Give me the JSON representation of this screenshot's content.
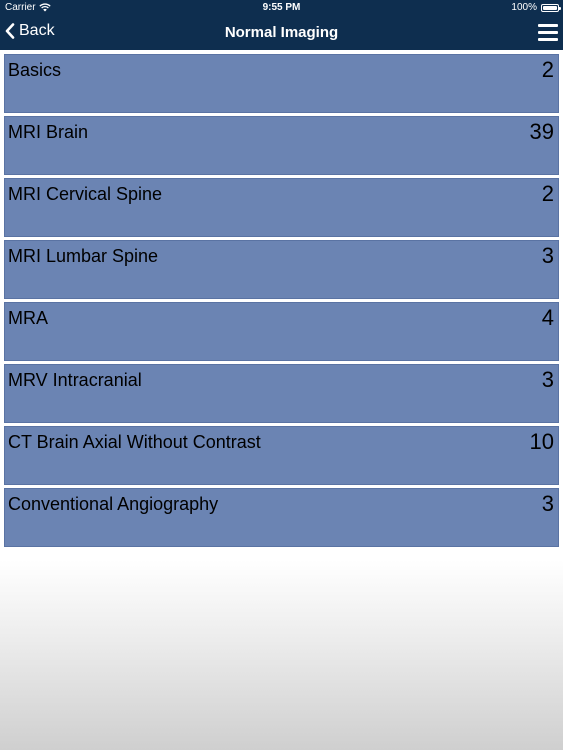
{
  "status_bar": {
    "carrier": "Carrier",
    "time": "9:55 PM",
    "battery": "100%",
    "battery_level": 1.0
  },
  "nav": {
    "back_label": "Back",
    "title": "Normal Imaging",
    "back_icon": "chevron-left-icon",
    "menu_icon": "hamburger-menu-icon"
  },
  "colors": {
    "nav_background": "#0e2e4f",
    "row_background": "#6b84b3"
  },
  "items": [
    {
      "label": "Basics",
      "count": "2"
    },
    {
      "label": "MRI Brain",
      "count": "39"
    },
    {
      "label": "MRI Cervical Spine",
      "count": "2"
    },
    {
      "label": "MRI Lumbar Spine",
      "count": "3"
    },
    {
      "label": "MRA",
      "count": "4"
    },
    {
      "label": "MRV Intracranial",
      "count": "3"
    },
    {
      "label": "CT Brain Axial Without Contrast",
      "count": "10"
    },
    {
      "label": "Conventional Angiography",
      "count": "3"
    }
  ]
}
